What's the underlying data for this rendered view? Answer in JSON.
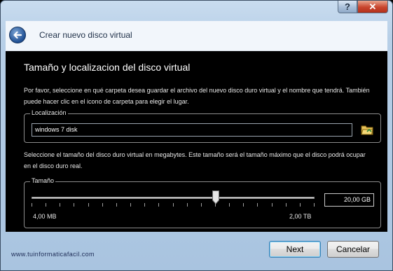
{
  "window": {
    "help_label": "?",
    "close_label": "✕"
  },
  "header": {
    "title": "Crear nuevo disco virtual"
  },
  "page": {
    "title": "Tamaño y localizacion del disco virtual",
    "description_1": "Por favor, seleccione en qué carpeta desea guardar el archivo del nuevo disco duro virtual y el nombre que tendrá. También puede hacer clic en el icono de carpeta para elegir el lugar.",
    "location": {
      "legend": "Localización",
      "value": "windows 7 disk"
    },
    "description_2": "Seleccione el tamaño del disco duro virtual en megabytes. Este tamaño será el tamaño máximo que el disco podrá ocupar en el disco duro real.",
    "size": {
      "legend": "Tamaño",
      "value": "20,00 GB",
      "min_label": "4,00 MB",
      "max_label": "2,00 TB",
      "slider_fraction": 0.65
    }
  },
  "footer": {
    "watermark": "www.tuinformaticafacil.com",
    "next_label": "Next",
    "cancel_label": "Cancelar"
  },
  "colors": {
    "content_bg": "#000000",
    "frame_blue": "#b7cfe7",
    "accent_blue": "#3c7fb1"
  },
  "icons": {
    "back": "back-arrow-icon",
    "folder": "folder-icon",
    "help": "help-icon",
    "close": "close-icon"
  }
}
